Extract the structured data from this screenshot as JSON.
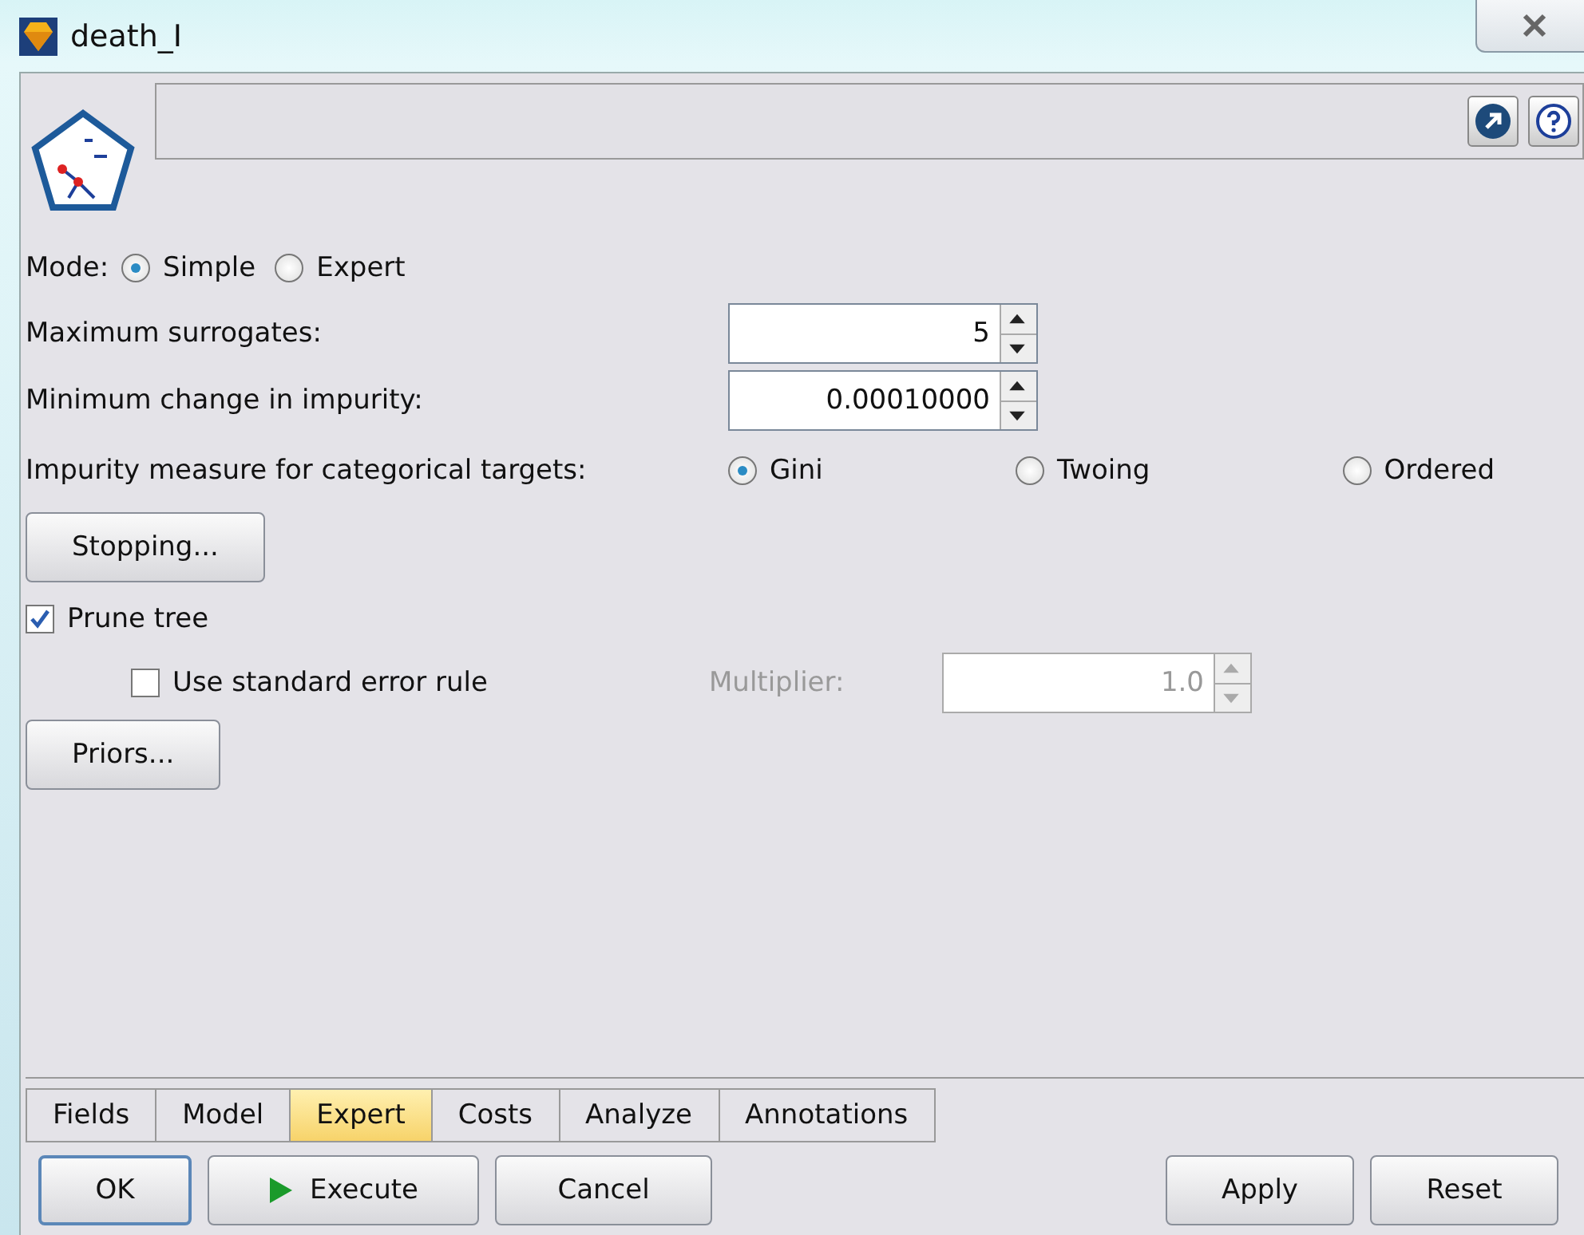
{
  "window": {
    "title": "death_I"
  },
  "mode": {
    "label": "Mode:",
    "options": [
      {
        "label": "Simple",
        "selected": true
      },
      {
        "label": "Expert",
        "selected": false
      }
    ]
  },
  "spinners": [
    {
      "label": "Maximum surrogates:",
      "value": "5"
    },
    {
      "label": "Minimum change in impurity:",
      "value": "0.00010000"
    }
  ],
  "impurity": {
    "label": "Impurity measure for categorical targets:",
    "options": [
      {
        "label": "Gini",
        "selected": true
      },
      {
        "label": "Twoing",
        "selected": false
      },
      {
        "label": "Ordered",
        "selected": false
      }
    ]
  },
  "stopping_button": "Stopping...",
  "prune": {
    "label": "Prune tree",
    "checked": true
  },
  "std_error": {
    "label": "Use standard error rule",
    "checked": false
  },
  "multiplier": {
    "label": "Multiplier:",
    "value": "1.0",
    "disabled": true
  },
  "priors_button": "Priors...",
  "tabs": [
    {
      "label": "Fields",
      "selected": false
    },
    {
      "label": "Model",
      "selected": false
    },
    {
      "label": "Expert",
      "selected": true
    },
    {
      "label": "Costs",
      "selected": false
    },
    {
      "label": "Analyze",
      "selected": false
    },
    {
      "label": "Annotations",
      "selected": false
    }
  ],
  "buttons": [
    {
      "label": "OK",
      "kind": "default"
    },
    {
      "label": "Execute",
      "kind": "run"
    },
    {
      "label": "Cancel",
      "kind": "plain"
    },
    {
      "label": "Apply",
      "kind": "plain"
    },
    {
      "label": "Reset",
      "kind": "plain"
    }
  ]
}
